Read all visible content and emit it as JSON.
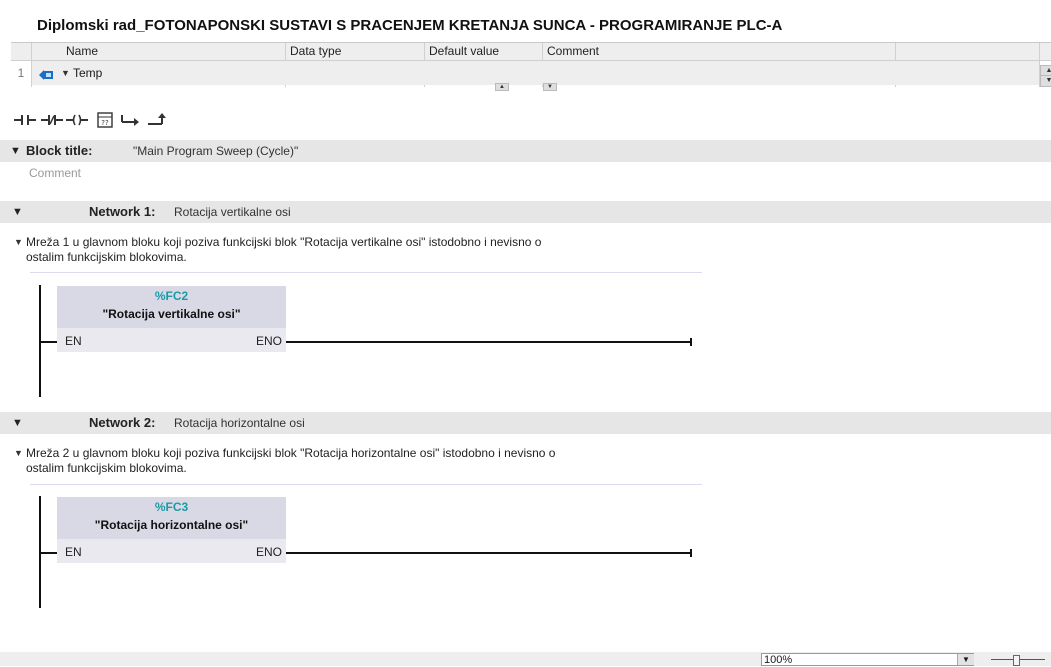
{
  "window": {
    "title": "Diplomski rad_FOTONAPONSKI SUSTAVI S PRACENJEM KRETANJA SUNCA - PROGRAMIRANJE PLC-A"
  },
  "interface": {
    "columns": {
      "name": "Name",
      "data_type": "Data type",
      "default_value": "Default value",
      "comment": "Comment"
    },
    "rows": [
      {
        "number": "1",
        "name": "Temp",
        "icon": "interface-section-icon"
      }
    ]
  },
  "toolbar": {
    "icons": [
      "no-contact-icon",
      "nc-contact-icon",
      "coil-icon",
      "empty-box-icon",
      "open-branch-icon",
      "close-branch-icon"
    ]
  },
  "block_title": {
    "label": "Block title:",
    "value": "\"Main Program Sweep (Cycle)\"",
    "comment_placeholder": "Comment"
  },
  "networks": [
    {
      "label": "Network 1:",
      "title": "Rotacija vertikalne osi",
      "comment_line1": "Mreža 1 u glavnom bloku koji poziva funkcijski blok \"Rotacija vertikalne osi\" istodobno i nevisno o",
      "comment_line2": "ostalim funkcijskim blokovima.",
      "block": {
        "address": "%FC2",
        "name": "\"Rotacija vertikalne osi\"",
        "en": "EN",
        "eno": "ENO"
      }
    },
    {
      "label": "Network 2:",
      "title": "Rotacija horizontalne osi",
      "comment_line1": "Mreža 2 u glavnom bloku koji poziva funkcijski blok \"Rotacija horizontalne osi\" istodobno i nevisno o",
      "comment_line2": "ostalim funkcijskim blokovima.",
      "block": {
        "address": "%FC3",
        "name": "\"Rotacija horizontalne osi\"",
        "en": "EN",
        "eno": "ENO"
      }
    }
  ],
  "status": {
    "zoom": "100%"
  },
  "colors": {
    "address": "#1e9aa6",
    "section_bar": "#e6e6e6",
    "block_fill": "#d8d9e4"
  }
}
